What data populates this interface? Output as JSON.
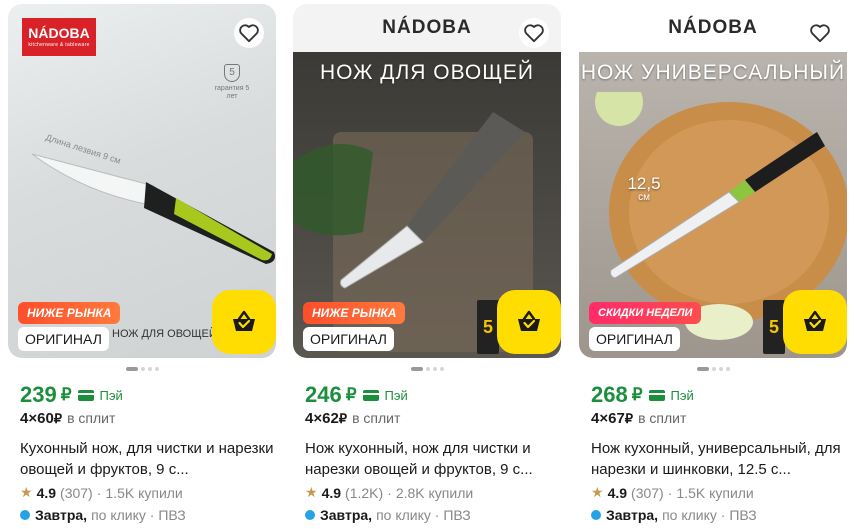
{
  "products": [
    {
      "brand_logo": "NÁDOBA",
      "brand_logo_sub": "kitchenware & tableware",
      "banner": "",
      "blade_note": "Длина лезвия 9 см",
      "warranty_number": "5",
      "warranty_text": "гарантия 5 лет",
      "promo": "НИЖЕ РЫНКА",
      "badge": "ОРИГИНАЛ",
      "photo_caption": "НОЖ ДЛЯ ОВОЩЕЙ",
      "price": "239",
      "currency": "₽",
      "pay_label": "Пэй",
      "split_amount": "4×60",
      "split_currency": "₽",
      "split_label": "в сплит",
      "title": "Кухонный нож, для чистки и нарезки овощей и фруктов, 9 с...",
      "rating": "4.9",
      "reviews": "(307)",
      "sep": "·",
      "bought": "1.5K купили",
      "delivery_day": "Завтра,",
      "delivery_rest": "по клику · ПВЗ",
      "knife_color": "#a8c81e"
    },
    {
      "brand_logo": "NÁDOBA",
      "banner": "НОЖ ДЛЯ ОВОЩЕЙ",
      "promo": "НИЖЕ РЫНКА",
      "badge": "ОРИГИНАЛ",
      "side_chip": "5",
      "price": "246",
      "currency": "₽",
      "pay_label": "Пэй",
      "split_amount": "4×62",
      "split_currency": "₽",
      "split_label": "в сплит",
      "title": "Нож кухонный, нож для чистки и нарезки овощей и фруктов, 9 с...",
      "rating": "4.9",
      "reviews": "(1.2K)",
      "sep": "·",
      "bought": "2.8K купили",
      "delivery_day": "Завтра,",
      "delivery_rest": "по клику · ПВЗ",
      "knife_color": "#6b6a66"
    },
    {
      "brand_logo": "NÁDOBA",
      "banner": "НОЖ УНИВЕРСАЛЬНЫЙ",
      "size_value": "12,5",
      "size_unit": "см",
      "promo": "СКИДКИ НЕДЕЛИ",
      "badge": "ОРИГИНАЛ",
      "side_chip": "5",
      "price": "268",
      "currency": "₽",
      "pay_label": "Пэй",
      "split_amount": "4×67",
      "split_currency": "₽",
      "split_label": "в сплит",
      "title": "Нож кухонный, универсальный, для нарезки и шинковки, 12.5 с...",
      "rating": "4.9",
      "reviews": "(307)",
      "sep": "·",
      "bought": "1.5K купили",
      "delivery_day": "Завтра,",
      "delivery_rest": "по клику · ПВЗ",
      "knife_color": "#8cc63f"
    }
  ],
  "colors": {
    "price_green": "#1c8f3d",
    "cart_yellow": "#ffdd00",
    "promo_orange": "#ff4e2b",
    "delivery_blue": "#24a3e8",
    "star": "#c49a54"
  },
  "icons": {
    "favorite": "heart-icon",
    "cart": "basket-icon",
    "pay": "card-icon",
    "rating": "star-icon",
    "warranty": "shield-icon"
  }
}
